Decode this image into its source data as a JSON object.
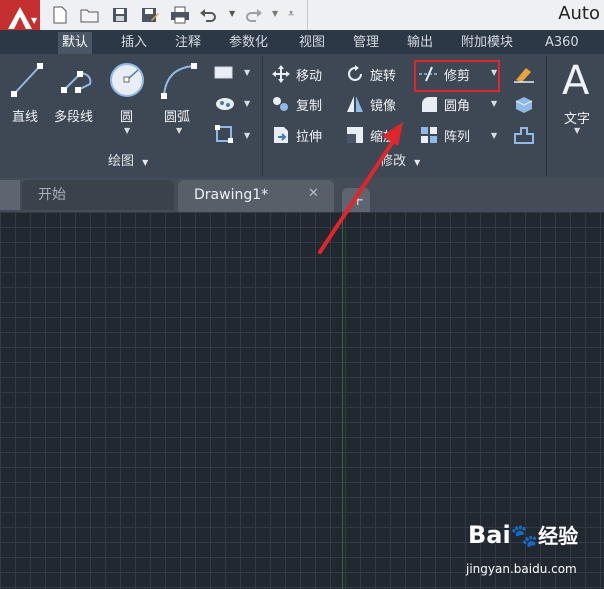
{
  "window": {
    "title": "Auto"
  },
  "tabs": [
    "默认",
    "插入",
    "注释",
    "参数化",
    "视图",
    "管理",
    "输出",
    "附加模块",
    "A360"
  ],
  "draw_panel": {
    "title": "绘图",
    "big_buttons": [
      "直线",
      "多段线",
      "圆",
      "圆弧"
    ]
  },
  "modify_panel": {
    "title": "修改",
    "buttons": [
      "移动",
      "旋转",
      "修剪",
      "复制",
      "镜像",
      "圆角",
      "拉伸",
      "缩放",
      "阵列"
    ]
  },
  "annotation_panel": {
    "text_label": "文字",
    "big_glyph": "A"
  },
  "doc_tabs": [
    "开始",
    "Drawing1*"
  ],
  "watermark": {
    "brand": "Bai",
    "brand2": "经验",
    "url": "jingyan.baidu.com"
  },
  "colors": {
    "highlight": "#e0262b",
    "arrow": "#e0262b",
    "accent": "#c62f2f"
  }
}
